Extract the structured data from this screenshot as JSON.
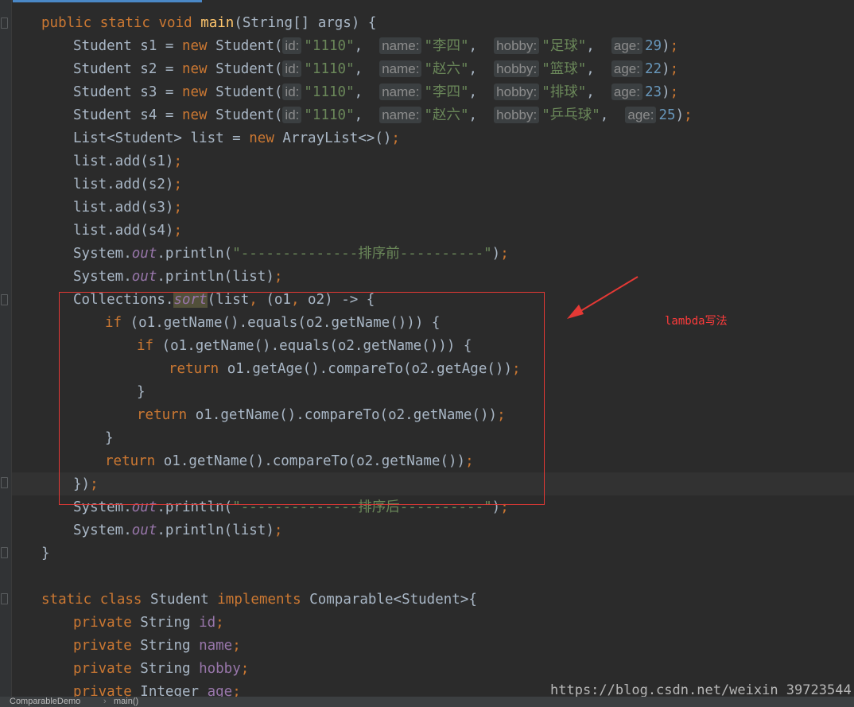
{
  "editor": {
    "lines": [
      {
        "tokens": [
          [
            "kw",
            "public static void "
          ],
          [
            "fn",
            "main"
          ],
          [
            "",
            "(String[] args) {"
          ]
        ]
      },
      {
        "tokens": [
          [
            "",
            "Student s1 = "
          ],
          [
            "kw",
            "new "
          ],
          [
            "",
            "Student("
          ],
          [
            "hint",
            "id:"
          ],
          [
            "str",
            "\"1110\""
          ],
          [
            "",
            ",  "
          ],
          [
            "hint",
            "name:"
          ],
          [
            "str",
            "\"李四\""
          ],
          [
            "",
            ",  "
          ],
          [
            "hint",
            "hobby:"
          ],
          [
            "str",
            "\"足球\""
          ],
          [
            "",
            ",  "
          ],
          [
            "hint",
            "age:"
          ],
          [
            "num",
            "29"
          ],
          [
            "",
            ")"
          ],
          [
            "kw",
            ";"
          ]
        ]
      },
      {
        "tokens": [
          [
            "",
            "Student s2 = "
          ],
          [
            "kw",
            "new "
          ],
          [
            "",
            "Student("
          ],
          [
            "hint",
            "id:"
          ],
          [
            "str",
            "\"1110\""
          ],
          [
            "",
            ",  "
          ],
          [
            "hint",
            "name:"
          ],
          [
            "str",
            "\"赵六\""
          ],
          [
            "",
            ",  "
          ],
          [
            "hint",
            "hobby:"
          ],
          [
            "str",
            "\"篮球\""
          ],
          [
            "",
            ",  "
          ],
          [
            "hint",
            "age:"
          ],
          [
            "num",
            "22"
          ],
          [
            "",
            ")"
          ],
          [
            "kw",
            ";"
          ]
        ]
      },
      {
        "tokens": [
          [
            "",
            "Student s3 = "
          ],
          [
            "kw",
            "new "
          ],
          [
            "",
            "Student("
          ],
          [
            "hint",
            "id:"
          ],
          [
            "str",
            "\"1110\""
          ],
          [
            "",
            ",  "
          ],
          [
            "hint",
            "name:"
          ],
          [
            "str",
            "\"李四\""
          ],
          [
            "",
            ",  "
          ],
          [
            "hint",
            "hobby:"
          ],
          [
            "str",
            "\"排球\""
          ],
          [
            "",
            ",  "
          ],
          [
            "hint",
            "age:"
          ],
          [
            "num",
            "23"
          ],
          [
            "",
            ")"
          ],
          [
            "kw",
            ";"
          ]
        ]
      },
      {
        "tokens": [
          [
            "",
            "Student s4 = "
          ],
          [
            "kw",
            "new "
          ],
          [
            "",
            "Student("
          ],
          [
            "hint",
            "id:"
          ],
          [
            "str",
            "\"1110\""
          ],
          [
            "",
            ",  "
          ],
          [
            "hint",
            "name:"
          ],
          [
            "str",
            "\"赵六\""
          ],
          [
            "",
            ",  "
          ],
          [
            "hint",
            "hobby:"
          ],
          [
            "str",
            "\"乒乓球\""
          ],
          [
            "",
            ",  "
          ],
          [
            "hint",
            "age:"
          ],
          [
            "num",
            "25"
          ],
          [
            "",
            ")"
          ],
          [
            "kw",
            ";"
          ]
        ]
      },
      {
        "tokens": [
          [
            "",
            "List<Student> list = "
          ],
          [
            "kw",
            "new "
          ],
          [
            "",
            "ArrayList<>()"
          ],
          [
            "kw",
            ";"
          ]
        ]
      },
      {
        "tokens": [
          [
            "",
            "list.add(s1)"
          ],
          [
            "kw",
            ";"
          ]
        ]
      },
      {
        "tokens": [
          [
            "",
            "list.add(s2)"
          ],
          [
            "kw",
            ";"
          ]
        ]
      },
      {
        "tokens": [
          [
            "",
            "list.add(s3)"
          ],
          [
            "kw",
            ";"
          ]
        ]
      },
      {
        "tokens": [
          [
            "",
            "list.add(s4)"
          ],
          [
            "kw",
            ";"
          ]
        ]
      },
      {
        "tokens": [
          [
            "",
            "System."
          ],
          [
            "stat",
            "out"
          ],
          [
            "",
            ".println("
          ],
          [
            "str",
            "\"--------------排序前----------\""
          ],
          [
            "",
            ")"
          ],
          [
            "kw",
            ";"
          ]
        ]
      },
      {
        "tokens": [
          [
            "",
            "System."
          ],
          [
            "stat",
            "out"
          ],
          [
            "",
            ".println(list)"
          ],
          [
            "kw",
            ";"
          ]
        ]
      },
      {
        "tokens": [
          [
            "",
            "Collections."
          ],
          [
            "sort",
            "sort"
          ],
          [
            "",
            "(list"
          ],
          [
            "kw",
            ", "
          ],
          [
            "",
            "(o1"
          ],
          [
            "kw",
            ", "
          ],
          [
            "",
            "o2) -> {"
          ]
        ]
      },
      {
        "tokens": [
          [
            "kw",
            "if "
          ],
          [
            "",
            "(o1.getName().equals(o2.getName())) {"
          ]
        ]
      },
      {
        "tokens": [
          [
            "kw",
            "if "
          ],
          [
            "",
            "(o1.getName().equals(o2.getName())) {"
          ]
        ]
      },
      {
        "tokens": [
          [
            "kw",
            "return "
          ],
          [
            "",
            "o1.getAge().compareTo(o2.getAge())"
          ],
          [
            "kw",
            ";"
          ]
        ]
      },
      {
        "tokens": [
          [
            "",
            "}"
          ]
        ]
      },
      {
        "tokens": [
          [
            "kw",
            "return "
          ],
          [
            "",
            "o1.getName().compareTo(o2.getName())"
          ],
          [
            "kw",
            ";"
          ]
        ]
      },
      {
        "tokens": [
          [
            "",
            "}"
          ]
        ]
      },
      {
        "tokens": [
          [
            "kw",
            "return "
          ],
          [
            "",
            "o1.getName().compareTo(o2.getName())"
          ],
          [
            "kw",
            ";"
          ]
        ]
      },
      {
        "tokens": [
          [
            "",
            "})"
          ],
          [
            "kw",
            ";"
          ]
        ]
      },
      {
        "tokens": [
          [
            "",
            "System."
          ],
          [
            "stat",
            "out"
          ],
          [
            "",
            ".println("
          ],
          [
            "str",
            "\"--------------排序后----------\""
          ],
          [
            "",
            ")"
          ],
          [
            "kw",
            ";"
          ]
        ]
      },
      {
        "tokens": [
          [
            "",
            "System."
          ],
          [
            "stat",
            "out"
          ],
          [
            "",
            ".println(list)"
          ],
          [
            "kw",
            ";"
          ]
        ]
      },
      {
        "tokens": [
          [
            "",
            "}"
          ]
        ]
      },
      {
        "tokens": []
      },
      {
        "tokens": [
          [
            "kw",
            "static class "
          ],
          [
            "",
            "Student "
          ],
          [
            "kw",
            "implements "
          ],
          [
            "",
            "Comparable<Student>{"
          ]
        ]
      },
      {
        "tokens": [
          [
            "kw",
            "private "
          ],
          [
            "",
            "String "
          ],
          [
            "fld",
            "id"
          ],
          [
            "kw",
            ";"
          ]
        ]
      },
      {
        "tokens": [
          [
            "kw",
            "private "
          ],
          [
            "",
            "String "
          ],
          [
            "fld",
            "name"
          ],
          [
            "kw",
            ";"
          ]
        ]
      },
      {
        "tokens": [
          [
            "kw",
            "private "
          ],
          [
            "",
            "String "
          ],
          [
            "fld",
            "hobby"
          ],
          [
            "kw",
            ";"
          ]
        ]
      },
      {
        "tokens": [
          [
            "kw",
            "private "
          ],
          [
            "",
            "Integer "
          ],
          [
            "fld",
            "age"
          ],
          [
            "kw",
            ";"
          ]
        ]
      }
    ]
  },
  "annotation": {
    "label": "lambda写法",
    "color": "#e53935"
  },
  "watermark": "https://blog.csdn.net/weixin_39723544",
  "statusbar": {
    "breadcrumbs": [
      "ComparableDemo",
      "main()"
    ]
  },
  "colors": {
    "background": "#2b2b2b",
    "keyword": "#cc7832",
    "string": "#6a8759",
    "number": "#6897bb",
    "function": "#ffc66d",
    "field": "#9876aa"
  }
}
